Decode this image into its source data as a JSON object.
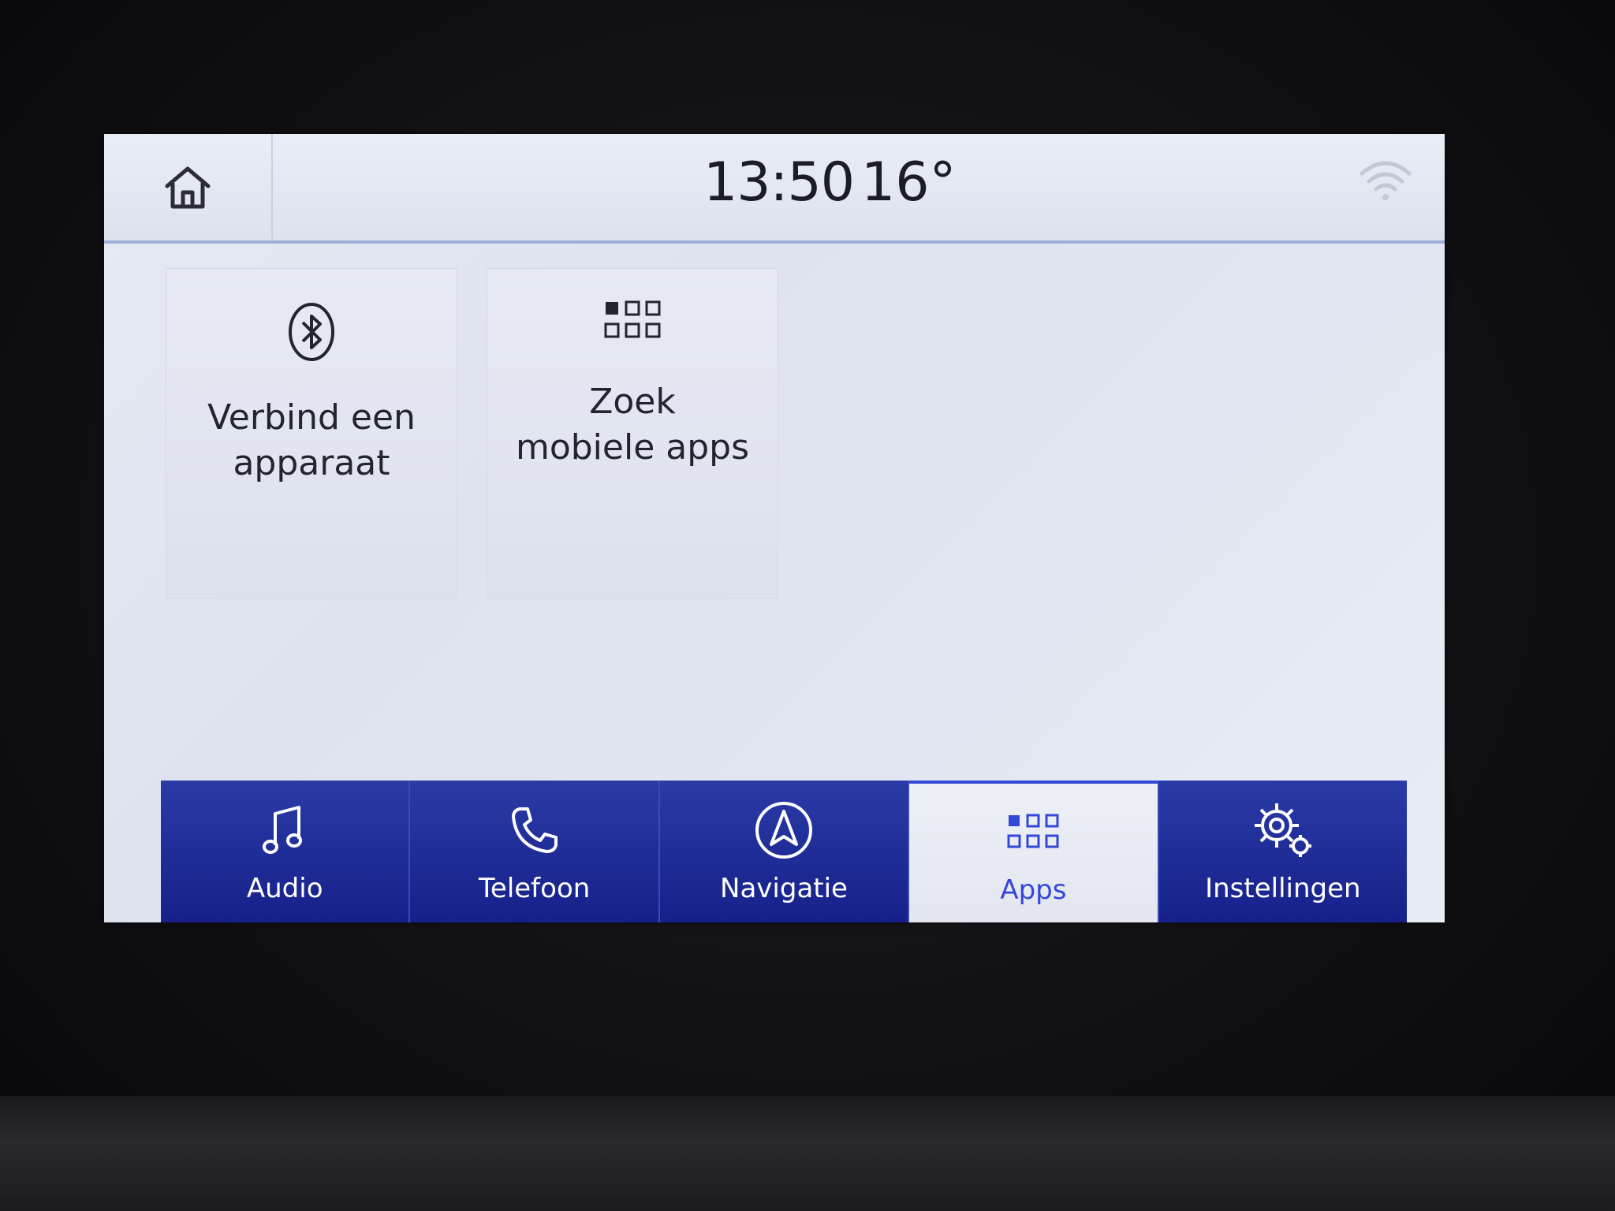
{
  "status": {
    "time": "13:50",
    "temperature": "16°"
  },
  "tiles": [
    {
      "label_line1": "Verbind een",
      "label_line2": "apparaat",
      "icon": "bluetooth-icon"
    },
    {
      "label_line1": "Zoek",
      "label_line2": "mobiele apps",
      "icon": "apps-grid-icon"
    }
  ],
  "nav": [
    {
      "label": "Audio",
      "icon": "music-note-icon",
      "active": false
    },
    {
      "label": "Telefoon",
      "icon": "phone-icon",
      "active": false
    },
    {
      "label": "Navigatie",
      "icon": "navigation-icon",
      "active": false
    },
    {
      "label": "Apps",
      "icon": "apps-grid-icon",
      "active": true
    },
    {
      "label": "Instellingen",
      "icon": "gear-icon",
      "active": false
    }
  ],
  "colors": {
    "nav_bg": "#1e2a98",
    "active_accent": "#3448d8",
    "screen_bg": "#e2e6f2"
  }
}
